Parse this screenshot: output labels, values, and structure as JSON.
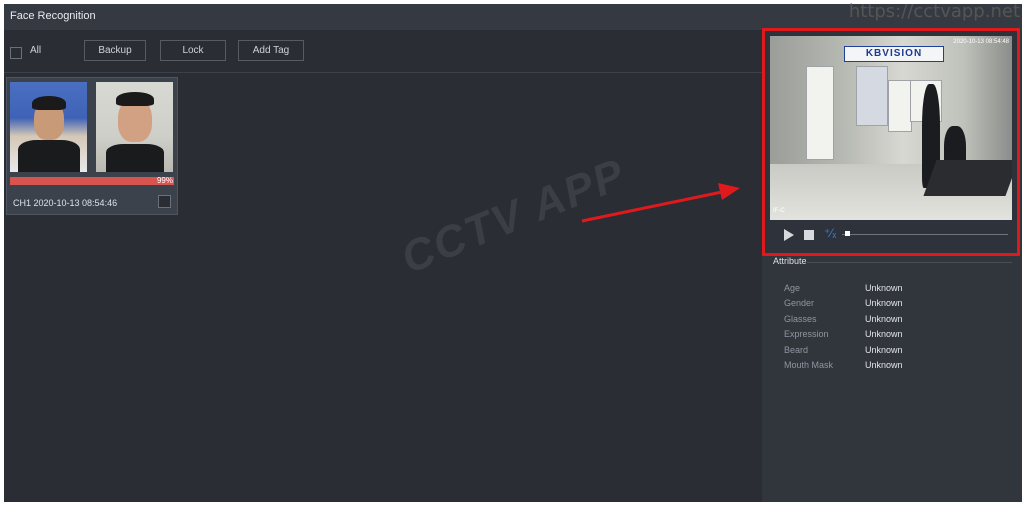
{
  "window": {
    "title": "Face Recognition"
  },
  "watermark_url": "https://cctvapp.net",
  "toolbar": {
    "all_label": "All",
    "buttons": [
      "Backup",
      "Lock",
      "Add Tag"
    ]
  },
  "results": [
    {
      "similarity": "99%",
      "caption": "CH1 2020-10-13 08:54:46"
    }
  ],
  "watermark_text": "CCTV APP",
  "video": {
    "sign": "KBVISION",
    "timestamp": "2020-10-13 08:54:48",
    "channel_label": "IF-C",
    "playback_progress": 0.02
  },
  "attribute": {
    "title": "Attribute",
    "rows": [
      {
        "key": "Age",
        "value": "Unknown"
      },
      {
        "key": "Gender",
        "value": "Unknown"
      },
      {
        "key": "Glasses",
        "value": "Unknown"
      },
      {
        "key": "Expression",
        "value": "Unknown"
      },
      {
        "key": "Beard",
        "value": "Unknown"
      },
      {
        "key": "Mouth Mask",
        "value": "Unknown"
      }
    ]
  },
  "colors": {
    "highlight": "#e0191c",
    "similarity_bar": "#d9534f",
    "accent": "#3f7fe0"
  },
  "icons": [
    "play-icon",
    "stop-icon",
    "slow-play-icon",
    "arrow-annotation"
  ]
}
